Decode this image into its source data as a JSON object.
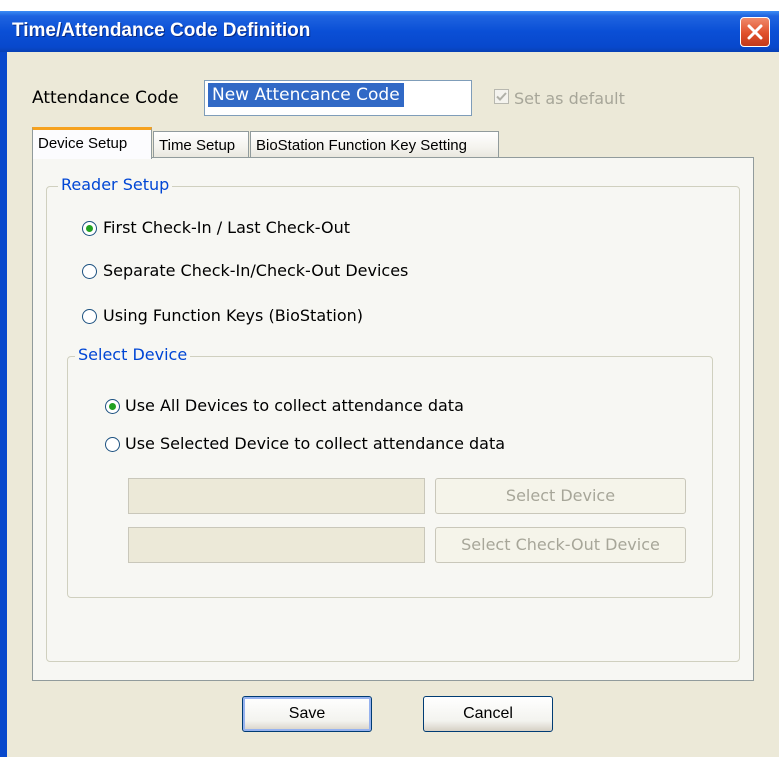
{
  "window": {
    "title": "Time/Attendance Code Definition"
  },
  "attendance_code": {
    "label": "Attendance Code",
    "value": "New Attencance Code",
    "set_default_label": "Set as default",
    "set_default_checked": true
  },
  "tabs": [
    {
      "label": "Device Setup",
      "active": true
    },
    {
      "label": "Time Setup",
      "active": false
    },
    {
      "label": "BioStation Function Key Setting",
      "active": false
    }
  ],
  "reader_setup": {
    "title": "Reader Setup",
    "options": [
      {
        "label": "First Check-In / Last Check-Out",
        "selected": true
      },
      {
        "label": "Separate Check-In/Check-Out Devices",
        "selected": false
      },
      {
        "label": "Using Function Keys (BioStation)",
        "selected": false
      }
    ]
  },
  "select_device": {
    "title": "Select Device",
    "options": [
      {
        "label": "Use All Devices to collect attendance data",
        "selected": true
      },
      {
        "label": "Use Selected Device to collect attendance data",
        "selected": false
      }
    ],
    "device_field": "",
    "checkout_field": "",
    "select_device_button": "Select Device",
    "select_checkout_button": "Select Check-Out Device"
  },
  "buttons": {
    "save": "Save",
    "cancel": "Cancel"
  },
  "colors": {
    "titlebar": "#0848cc",
    "group_title": "#0046d5",
    "active_tab_accent": "#f6a21f",
    "close_button": "#e0502b"
  },
  "icons": {
    "close": "close-icon",
    "checkbox": "checkmark-icon"
  }
}
